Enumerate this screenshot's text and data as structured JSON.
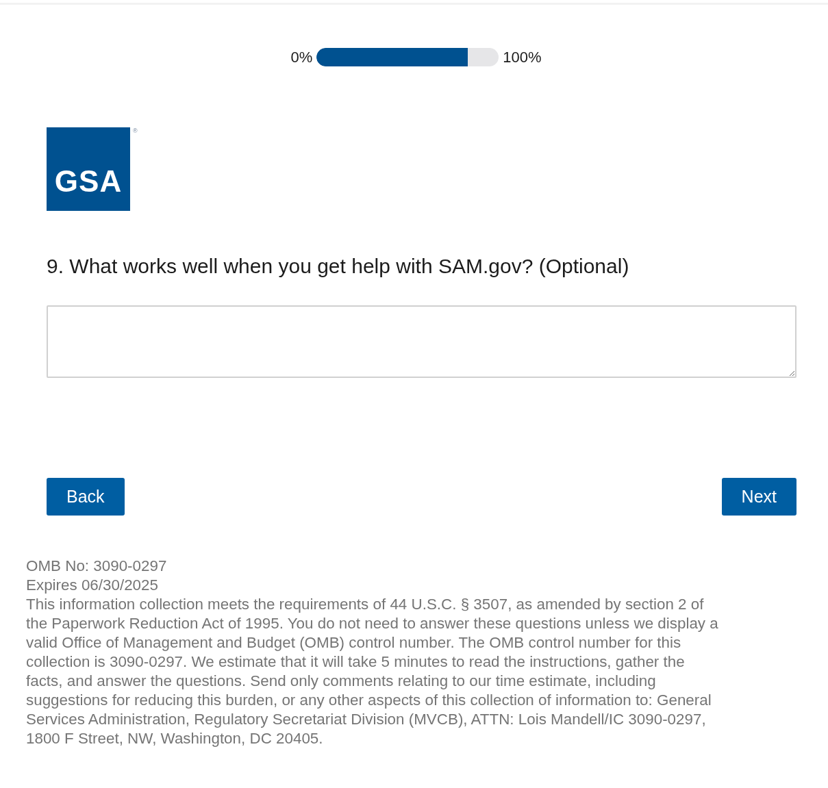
{
  "progress": {
    "start_label": "0%",
    "end_label": "100%",
    "level": 0.83
  },
  "logo": {
    "text": "GSA",
    "mark": "®"
  },
  "question": {
    "label": "9. What works well when you get help with SAM.gov? (Optional)"
  },
  "buttons": [
    {
      "label": "Back"
    },
    {
      "label": "Next"
    }
  ],
  "footer": {
    "omb_number": "OMB No: 3090-0297",
    "expires": "Expires 06/30/2025",
    "notice": "This information collection meets the requirements of 44 U.S.C. § 3507, as amended by section 2 of the Paperwork Reduction Act of 1995. You do not need to answer these questions unless we display a valid Office of Management and Budget (OMB) control number. The OMB control number for this collection is 3090-0297. We estimate that it will take 5 minutes to read the instructions, gather the facts, and answer the questions. Send only comments relating to our time estimate, including suggestions for reducing this burden, or any other aspects of this collection of information to: General Services Administration, Regulatory Secretariat Division (MVCB), ATTN: Lois Mandell/IC 3090-0297, 1800 F Street, NW, Washington, DC 20405."
  }
}
